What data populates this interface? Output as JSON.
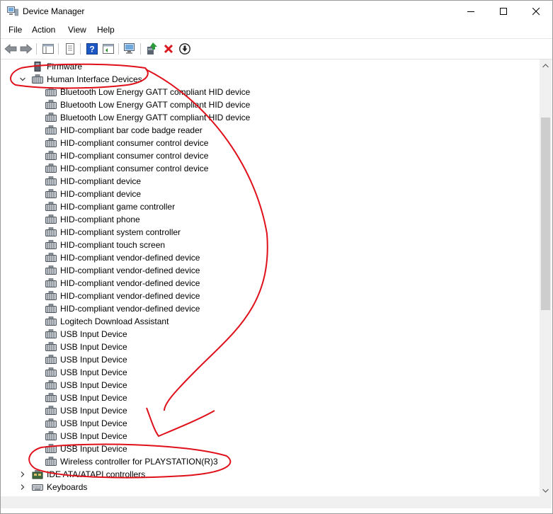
{
  "window": {
    "title": "Device Manager"
  },
  "menu": {
    "file": "File",
    "action": "Action",
    "view": "View",
    "help": "Help"
  },
  "tree": {
    "firmware": "Firmware",
    "hid_category": "Human Interface Devices",
    "hid_devices": [
      "Bluetooth Low Energy GATT compliant HID device",
      "Bluetooth Low Energy GATT compliant HID device",
      "Bluetooth Low Energy GATT compliant HID device",
      "HID-compliant bar code badge reader",
      "HID-compliant consumer control device",
      "HID-compliant consumer control device",
      "HID-compliant consumer control device",
      "HID-compliant device",
      "HID-compliant device",
      "HID-compliant game controller",
      "HID-compliant phone",
      "HID-compliant system controller",
      "HID-compliant touch screen",
      "HID-compliant vendor-defined device",
      "HID-compliant vendor-defined device",
      "HID-compliant vendor-defined device",
      "HID-compliant vendor-defined device",
      "HID-compliant vendor-defined device",
      "Logitech Download Assistant",
      "USB Input Device",
      "USB Input Device",
      "USB Input Device",
      "USB Input Device",
      "USB Input Device",
      "USB Input Device",
      "USB Input Device",
      "USB Input Device",
      "USB Input Device",
      "USB Input Device",
      "Wireless controller for PLAYSTATION(R)3"
    ],
    "ide_category": "IDE ATA/ATAPI controllers",
    "keyboards_category": "Keyboards"
  },
  "colors": {
    "annotation": "#e0101a",
    "uninstall": "#d9181f",
    "help": "#1c57c4"
  }
}
